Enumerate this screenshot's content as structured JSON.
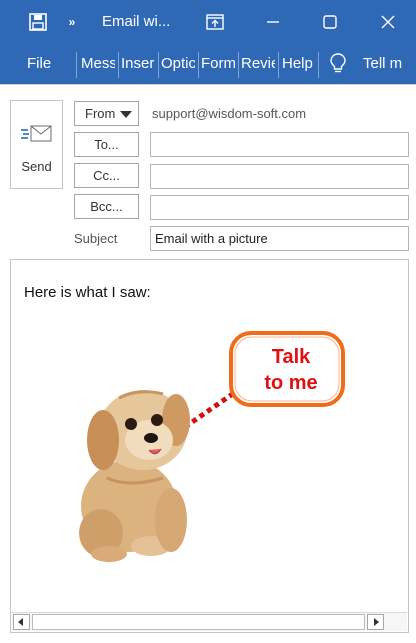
{
  "window": {
    "title": "Email wi...",
    "icons": [
      "save-icon",
      "more-commands-icon",
      "restore-ribbon-icon",
      "minimize-icon",
      "maximize-icon",
      "close-icon"
    ]
  },
  "ribbon": {
    "tabs": [
      "File",
      "Mess",
      "Inser",
      "Optic",
      "Form",
      "Revie",
      "Help"
    ],
    "tell_me_icon": "lightbulb-icon",
    "tell_me": "Tell m"
  },
  "compose": {
    "send_label": "Send",
    "send_icon": "send-envelope-icon",
    "from_label": "From",
    "from_value": "support@wisdom-soft.com",
    "to_label": "To...",
    "to_value": "",
    "cc_label": "Cc...",
    "cc_value": "",
    "bcc_label": "Bcc...",
    "bcc_value": "",
    "subject_label": "Subject",
    "subject_value": "Email with a picture"
  },
  "body": {
    "text": "Here is what I saw:",
    "picture": {
      "bubble_line1": "Talk",
      "bubble_line2": "to me",
      "bubble_border_color": "#ef6c1a",
      "bubble_text_color": "#e01010"
    }
  },
  "colors": {
    "titlebar": "#2f69b5",
    "ribbon": "#2f69b5"
  }
}
